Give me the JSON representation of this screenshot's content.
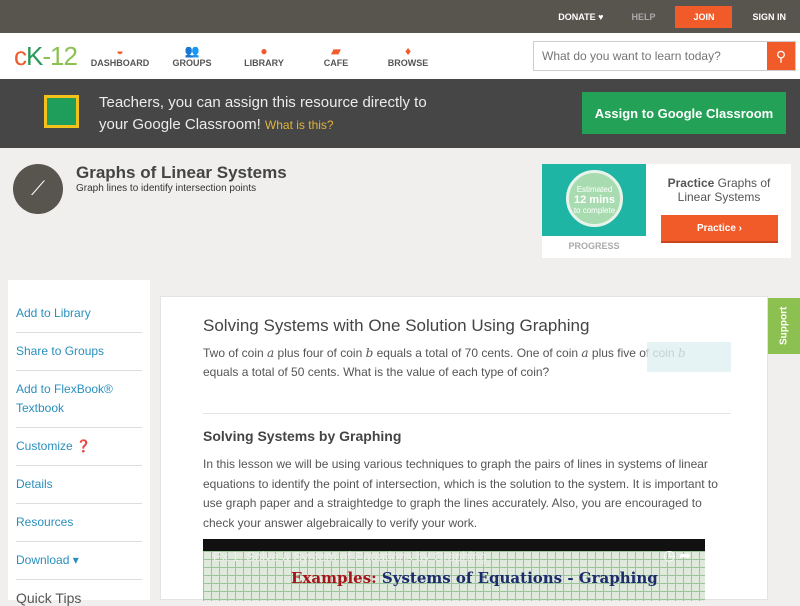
{
  "topbar": {
    "donate": "DONATE ♥",
    "help": "HELP",
    "join": "JOIN",
    "signin": "SIGN IN"
  },
  "nav": {
    "logo": [
      "c",
      "K",
      "-12"
    ],
    "items": [
      {
        "label": "DASHBOARD",
        "icon": "◒"
      },
      {
        "label": "GROUPS",
        "icon": "👥"
      },
      {
        "label": "LIBRARY",
        "icon": "●"
      },
      {
        "label": "CAFE",
        "icon": "▰"
      },
      {
        "label": "BROWSE",
        "icon": "♦"
      }
    ],
    "search_placeholder": "What do you want to learn today?",
    "search_icon": "⚲"
  },
  "banner": {
    "text": "Teachers, you can assign this resource directly to your Google Classroom!",
    "link": "What is this?",
    "button": "Assign to Google Classroom"
  },
  "header": {
    "icon": "⟋",
    "title": "Graphs of Linear Systems",
    "subtitle": "Graph lines to identify intersection points"
  },
  "practice": {
    "est1": "Estimated",
    "est2": "12 mins",
    "est3": "to complete",
    "progress": "PROGRESS",
    "bold": "Practice",
    "title": "Graphs of Linear Systems",
    "button": "Practice ›"
  },
  "sidebar": {
    "items": [
      "Add to Library",
      "Share to Groups",
      "Add to FlexBook® Textbook",
      "Customize ❓",
      "Details",
      "Resources",
      "Download ▾"
    ],
    "quick_tips": "Quick Tips"
  },
  "main": {
    "heading": "Solving Systems with One Solution Using Graphing",
    "q_parts": [
      "Two of coin ",
      "a",
      " plus four of coin ",
      "b",
      " equals a total of 70 cents. One of coin ",
      "a",
      " plus five of coin ",
      "b",
      " equals a total of 50 cents. What is the value of each type of coin?"
    ],
    "section": "Solving Systems by Graphing",
    "paragraph": "In this lesson we will be using various techniques to graph the pairs of lines in systems of linear equations to identify the point of intersection, which is the solution to the system. It is important to use graph paper and a straightedge to graph the lines accurately. Also, you are encouraged to check your answer algebraically to verify your work.",
    "video_title": "Ex 1: Solve a System of Equations by Graphing",
    "video_ex1": "Examples:",
    "video_ex2": " Systems of Equations - Graphing",
    "video_ctl": "◷ ➦"
  },
  "support": "Support"
}
